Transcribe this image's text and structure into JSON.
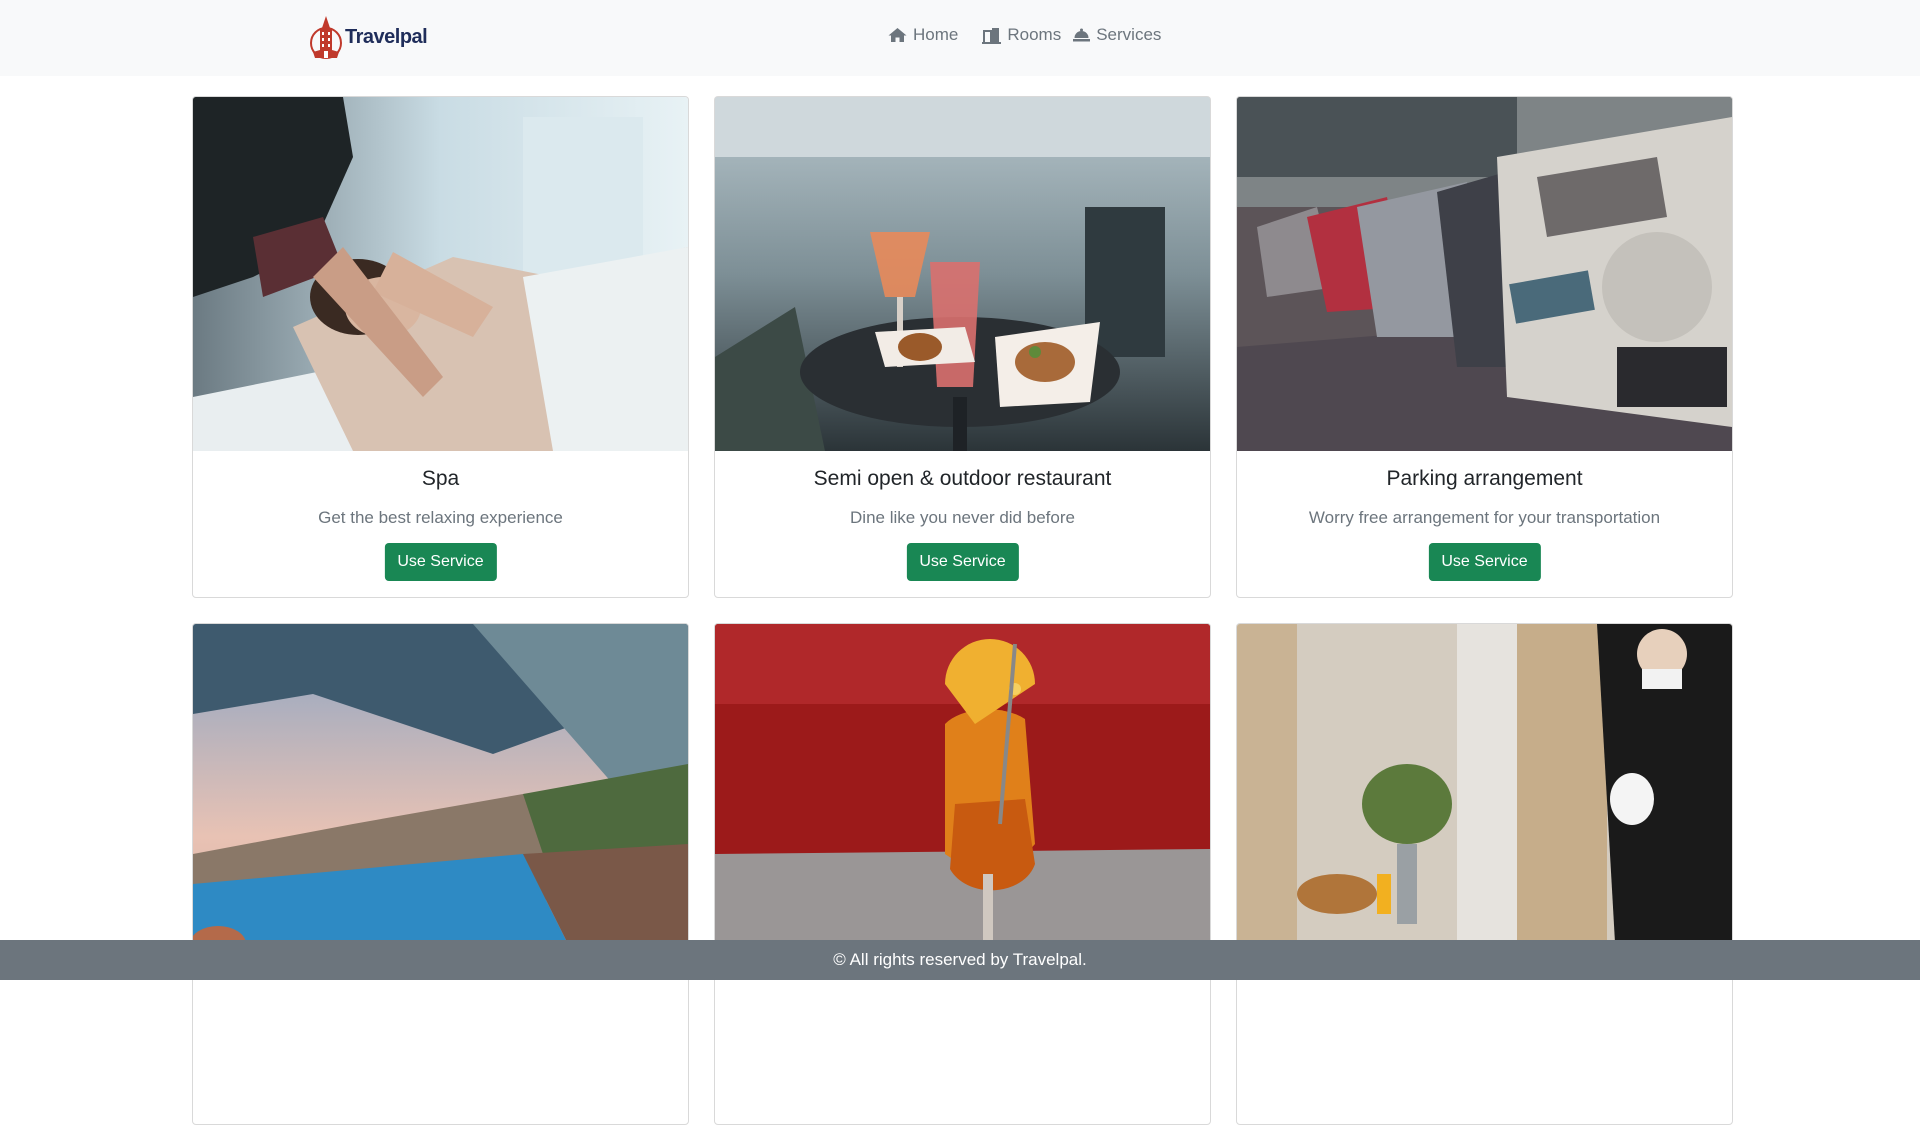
{
  "brand": {
    "name": "Travelpal"
  },
  "nav": {
    "items": [
      {
        "label": "Home",
        "icon": "home-icon"
      },
      {
        "label": "Rooms",
        "icon": "rooms-icon"
      },
      {
        "label": "Services",
        "icon": "bell-icon"
      }
    ]
  },
  "services": [
    {
      "title": "Spa",
      "description": "Get the best relaxing experience",
      "button": "Use Service"
    },
    {
      "title": "Semi open & outdoor restaurant",
      "description": "Dine like you never did before",
      "button": "Use Service"
    },
    {
      "title": "Parking arrangement",
      "description": "Worry free arrangement for your transportation",
      "button": "Use Service"
    }
  ],
  "footer": {
    "text": "© All rights reserved by Travelpal."
  },
  "colors": {
    "button": "#198754",
    "navbar": "#f8f9fa",
    "footer": "#6c757d",
    "brand": "#1f2d5a",
    "logo": "#c0392b"
  }
}
